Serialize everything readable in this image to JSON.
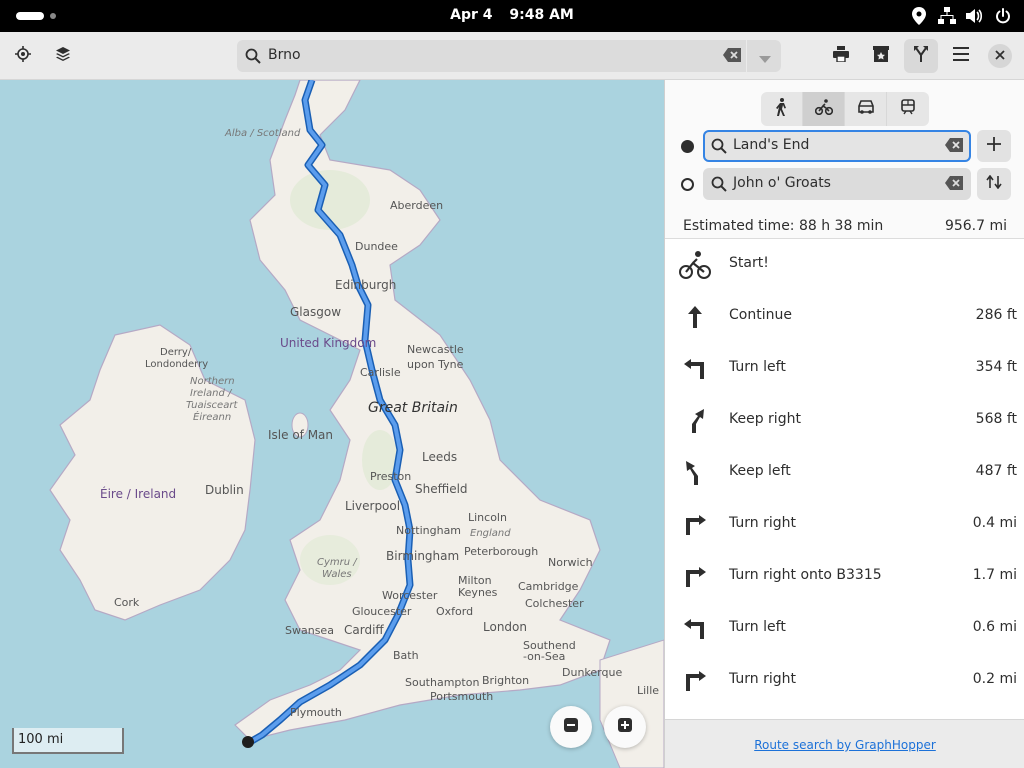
{
  "system_bar": {
    "date": "Apr 4",
    "time": "9:48 AM",
    "tray_icons": [
      "location-icon",
      "network-icon",
      "volume-icon",
      "power-icon"
    ]
  },
  "header": {
    "search": {
      "value": "Brno"
    },
    "buttons": [
      "locate-icon",
      "layers-icon",
      "print-icon",
      "favorites-icon",
      "route-icon",
      "menu-icon",
      "close-icon"
    ]
  },
  "map": {
    "labels": {
      "alba": "Alba / Scotland",
      "aberdeen": "Aberdeen",
      "dundee": "Dundee",
      "edinburgh": "Edinburgh",
      "glasgow": "Glasgow",
      "united_kingdom": "United Kingdom",
      "newcastle1": "Newcastle",
      "newcastle2": "upon Tyne",
      "carlisle": "Carlisle",
      "derry1": "Derry/",
      "derry2": "Londonderry",
      "ni1": "Northern",
      "ni2": "Ireland /",
      "ni3": "Tuaisceart",
      "ni4": "Éireann",
      "great_britain": "Great Britain",
      "isle_of_man": "Isle of Man",
      "leeds": "Leeds",
      "preston": "Preston",
      "sheffield": "Sheffield",
      "eire": "Éire / Ireland",
      "dublin": "Dublin",
      "liverpool": "Liverpool",
      "nottingham": "Nottingham",
      "lincoln": "Lincoln",
      "england": "England",
      "birmingham": "Birmingham",
      "peterborough": "Peterborough",
      "norwich": "Norwich",
      "cymru1": "Cymru /",
      "cymru2": "Wales",
      "worcester": "Worcester",
      "milton1": "Milton",
      "milton2": "Keynes",
      "cambridge": "Cambridge",
      "colchester": "Colchester",
      "cork": "Cork",
      "gloucester": "Gloucester",
      "oxford": "Oxford",
      "swansea": "Swansea",
      "cardiff": "Cardiff",
      "london": "London",
      "southend1": "Southend",
      "southend2": "-on-Sea",
      "bath": "Bath",
      "southampton": "Southampton",
      "brighton": "Brighton",
      "dunkerque": "Dunkerque",
      "portsmouth": "Portsmouth",
      "plymouth": "Plymouth",
      "lille": "Lille"
    },
    "scale": "100 mi"
  },
  "route": {
    "modes": [
      "walk-icon",
      "bike-icon",
      "car-icon",
      "transit-icon"
    ],
    "active_mode": "bike",
    "from": "Land's End",
    "to": "John o' Groats",
    "estimated_time": "Estimated time: 88 h 38 min",
    "distance": "956.7 mi",
    "steps": [
      {
        "icon": "bike-start-icon",
        "text": "Start!",
        "dist": ""
      },
      {
        "icon": "arrow-up-icon",
        "text": "Continue",
        "dist": "286 ft"
      },
      {
        "icon": "turn-left-icon",
        "text": "Turn left",
        "dist": "354 ft"
      },
      {
        "icon": "keep-right-icon",
        "text": "Keep right",
        "dist": "568 ft"
      },
      {
        "icon": "keep-left-icon",
        "text": "Keep left",
        "dist": "487 ft"
      },
      {
        "icon": "turn-right-icon",
        "text": "Turn right",
        "dist": "0.4 mi"
      },
      {
        "icon": "turn-right-icon",
        "text": "Turn right onto B3315",
        "dist": "1.7 mi"
      },
      {
        "icon": "turn-left-icon",
        "text": "Turn left",
        "dist": "0.6 mi"
      },
      {
        "icon": "turn-right-icon",
        "text": "Turn right",
        "dist": "0.2 mi"
      }
    ],
    "attribution": "Route search by GraphHopper"
  }
}
